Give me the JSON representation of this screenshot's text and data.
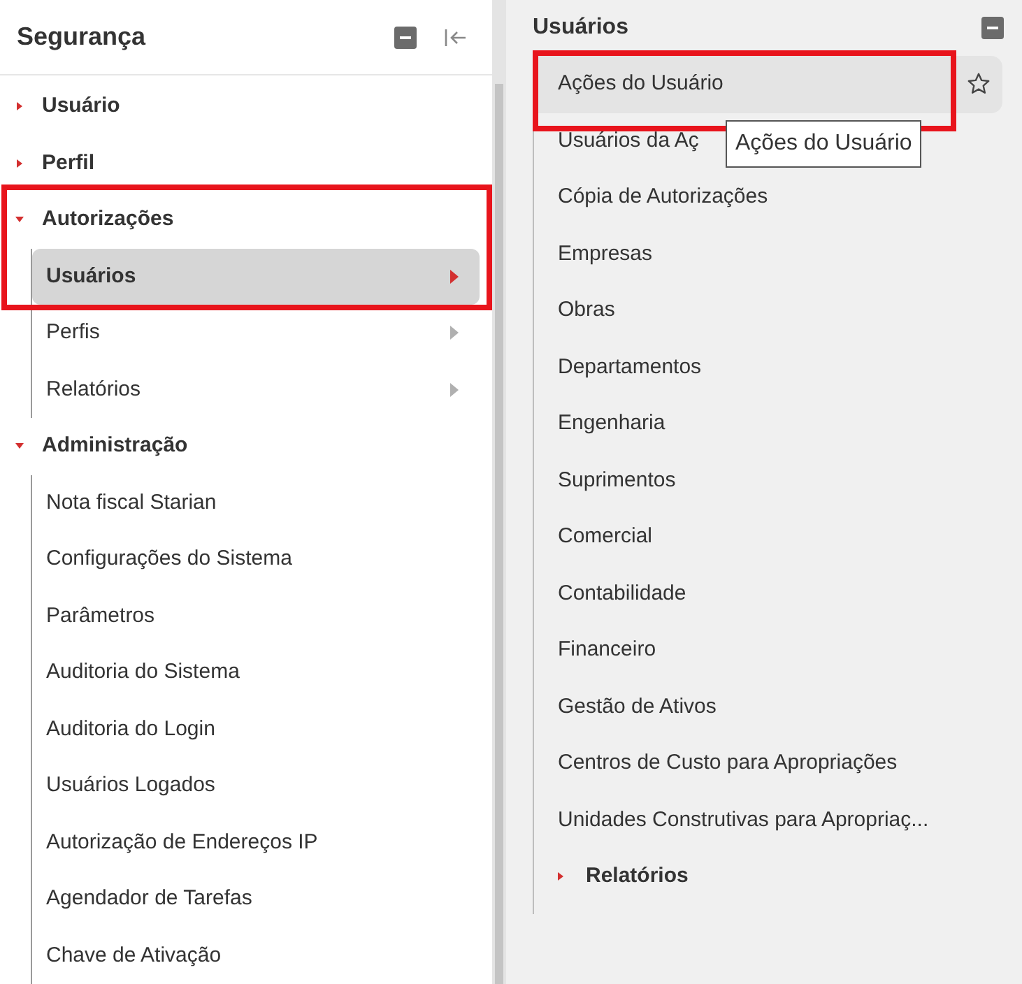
{
  "left_panel": {
    "title": "Segurança",
    "tree": [
      {
        "label": "Usuário",
        "expanded": false
      },
      {
        "label": "Perfil",
        "expanded": false
      },
      {
        "label": "Autorizações",
        "expanded": true,
        "children": [
          {
            "label": "Usuários",
            "kind": "submenu",
            "selected": true,
            "highlighted": true
          },
          {
            "label": "Perfis",
            "kind": "submenu",
            "selected": false,
            "highlighted": false
          },
          {
            "label": "Relatórios",
            "kind": "submenu",
            "selected": false,
            "highlighted": false
          }
        ]
      },
      {
        "label": "Administração",
        "expanded": true,
        "children": [
          {
            "label": "Nota fiscal Starian",
            "kind": "link",
            "selected": false,
            "highlighted": false
          },
          {
            "label": "Configurações do Sistema",
            "kind": "link",
            "selected": false,
            "highlighted": false
          },
          {
            "label": "Parâmetros",
            "kind": "link",
            "selected": false,
            "highlighted": false
          },
          {
            "label": "Auditoria do Sistema",
            "kind": "link",
            "selected": false,
            "highlighted": false
          },
          {
            "label": "Auditoria do Login",
            "kind": "link",
            "selected": false,
            "highlighted": false
          },
          {
            "label": "Usuários Logados",
            "kind": "link",
            "selected": false,
            "highlighted": false
          },
          {
            "label": "Autorização de Endereços IP",
            "kind": "link",
            "selected": false,
            "highlighted": false
          },
          {
            "label": "Agendador de Tarefas",
            "kind": "link",
            "selected": false,
            "highlighted": false
          },
          {
            "label": "Chave de Ativação",
            "kind": "link",
            "selected": false,
            "highlighted": false
          }
        ]
      }
    ]
  },
  "right_panel": {
    "title": "Usuários",
    "items": [
      {
        "label": "Ações do Usuário",
        "hovered": true,
        "highlighted": true,
        "tooltip": "Ações do Usuário"
      },
      {
        "label": "Usuários da Aç",
        "hovered": false,
        "highlighted": false
      },
      {
        "label": "Cópia de Autorizações",
        "hovered": false,
        "highlighted": false
      },
      {
        "label": "Empresas",
        "hovered": false,
        "highlighted": false
      },
      {
        "label": "Obras",
        "hovered": false,
        "highlighted": false
      },
      {
        "label": "Departamentos",
        "hovered": false,
        "highlighted": false
      },
      {
        "label": "Engenharia",
        "hovered": false,
        "highlighted": false
      },
      {
        "label": "Suprimentos",
        "hovered": false,
        "highlighted": false
      },
      {
        "label": "Comercial",
        "hovered": false,
        "highlighted": false
      },
      {
        "label": "Contabilidade",
        "hovered": false,
        "highlighted": false
      },
      {
        "label": "Financeiro",
        "hovered": false,
        "highlighted": false
      },
      {
        "label": "Gestão de Ativos",
        "hovered": false,
        "highlighted": false
      },
      {
        "label": "Centros de Custo para Apropriações",
        "hovered": false,
        "highlighted": false
      },
      {
        "label": "Unidades Construtivas para Apropriaç...",
        "hovered": false,
        "highlighted": false
      }
    ],
    "groups": [
      {
        "label": "Relatórios",
        "expanded": false
      }
    ]
  }
}
